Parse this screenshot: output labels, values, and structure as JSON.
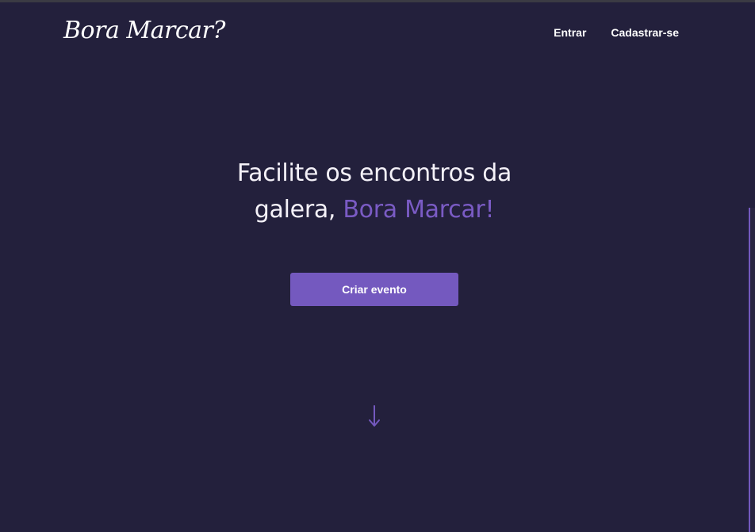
{
  "header": {
    "logo": "Bora Marcar?",
    "nav": {
      "login_label": "Entrar",
      "signup_label": "Cadastrar-se"
    }
  },
  "hero": {
    "title_line1": "Facilite os encontros da",
    "title_line2_prefix": "galera, ",
    "title_highlight": "Bora Marcar!",
    "cta_label": "Criar evento"
  },
  "icons": {
    "scroll_down": "arrow-down-icon"
  },
  "colors": {
    "background": "#23203c",
    "accent": "#7459bf",
    "text": "#f4f1f8"
  }
}
